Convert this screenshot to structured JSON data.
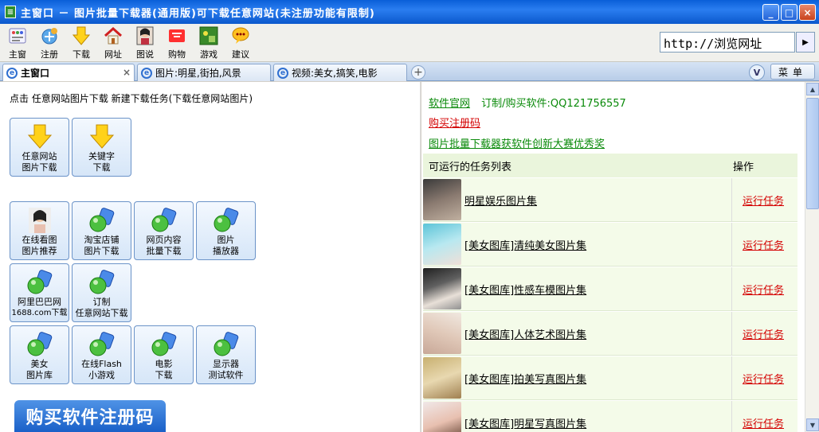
{
  "window": {
    "title": "主窗口 － 图片批量下载器(通用版)可下载任意网站(未注册功能有限制)",
    "controls": [
      "_",
      "□",
      "×"
    ]
  },
  "toolbar": {
    "items": [
      {
        "label": "主窗",
        "icon": "grid-icon"
      },
      {
        "label": "注册",
        "icon": "register-icon"
      },
      {
        "label": "下载",
        "icon": "download-arrow-icon"
      },
      {
        "label": "网址",
        "icon": "home-icon"
      },
      {
        "label": "图说",
        "icon": "photo-icon"
      },
      {
        "label": "购物",
        "icon": "shopping-icon"
      },
      {
        "label": "游戏",
        "icon": "game-icon"
      },
      {
        "label": "建议",
        "icon": "chat-bubble-icon"
      }
    ],
    "url_value": "http://浏览网址",
    "go": "▶"
  },
  "tabs": {
    "items": [
      {
        "label": "主窗口",
        "active": true,
        "close": "×"
      },
      {
        "label": "图片:明星,街拍,风景",
        "active": false
      },
      {
        "label": "视频:美女,搞笑,电影",
        "active": false
      }
    ],
    "add": "+",
    "v": "V",
    "menu": "菜单"
  },
  "left": {
    "instruction": "点击 任意网站图片下载 新建下载任务(下载任意网站图片)",
    "tiles": [
      {
        "label1": "任意网站",
        "label2": "图片下载",
        "icon": "download-arrow-icon"
      },
      {
        "label1": "关键字",
        "label2": "下载",
        "icon": "download-arrow-icon"
      },
      {
        "label1": "在线看图",
        "label2": "图片推荐",
        "icon": "photo-icon"
      },
      {
        "label1": "淘宝店铺",
        "label2": "图片下载",
        "icon": "plugin-icon"
      },
      {
        "label1": "网页内容",
        "label2": "批量下载",
        "icon": "plugin-icon"
      },
      {
        "label1": "图片",
        "label2": "播放器",
        "icon": "plugin-icon"
      },
      {
        "label1": "阿里巴巴网",
        "label2": "1688.com下载",
        "icon": "plugin-icon"
      },
      {
        "label1": "订制",
        "label2": "任意网站下载",
        "icon": "plugin-icon"
      },
      {
        "label1": "美女",
        "label2": "图片库",
        "icon": "plugin-icon"
      },
      {
        "label1": "在线Flash",
        "label2": "小游戏",
        "icon": "plugin-icon"
      },
      {
        "label1": "电影",
        "label2": "下载",
        "icon": "plugin-icon"
      },
      {
        "label1": "显示器",
        "label2": "测试软件",
        "icon": "plugin-icon"
      }
    ],
    "buy_banner": "购买软件注册码"
  },
  "right": {
    "official": "软件官网",
    "order": "订制/购买软件:QQ121756557",
    "buy_code": "购买注册码",
    "award": "图片批量下载器获软件创新大赛优秀奖",
    "task_header": "可运行的任务列表",
    "op_header": "操作",
    "tasks": [
      {
        "name": "明星娱乐图片集",
        "action": "运行任务"
      },
      {
        "name": "[美女图库]清纯美女图片集",
        "action": "运行任务"
      },
      {
        "name": "[美女图库]性感车模图片集",
        "action": "运行任务"
      },
      {
        "name": "[美女图库]人体艺术图片集",
        "action": "运行任务"
      },
      {
        "name": "[美女图库]拍美写真图片集",
        "action": "运行任务"
      },
      {
        "name": "[美女图库]明星写真图片集",
        "action": "运行任务"
      }
    ]
  },
  "scroll": {
    "up": "▲",
    "down": "▼"
  }
}
